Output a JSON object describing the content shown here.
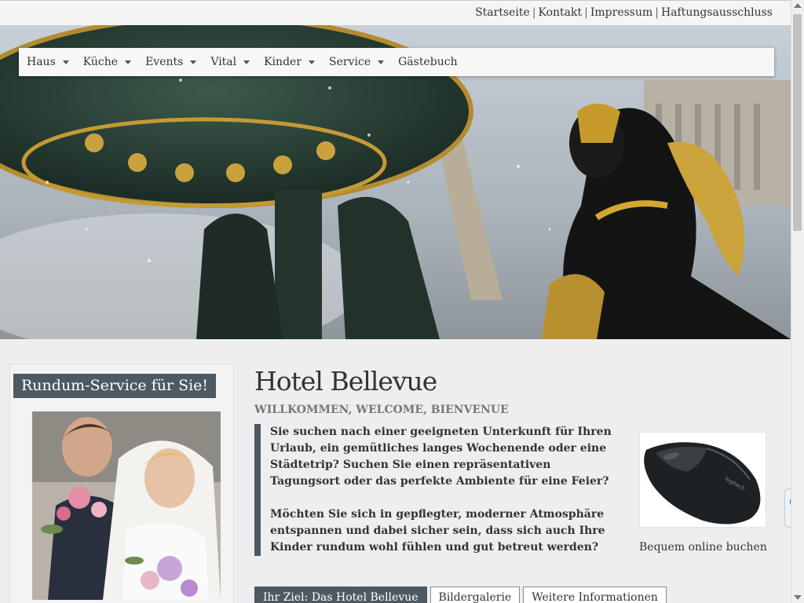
{
  "top_links": [
    {
      "label": "Startseite"
    },
    {
      "label": "Kontakt"
    },
    {
      "label": "Impressum"
    },
    {
      "label": "Haftungsausschluss"
    }
  ],
  "top_links_separator": "|",
  "nav": [
    {
      "label": "Haus",
      "has_dropdown": true
    },
    {
      "label": "Küche",
      "has_dropdown": true
    },
    {
      "label": "Events",
      "has_dropdown": true
    },
    {
      "label": "Vital",
      "has_dropdown": true
    },
    {
      "label": "Kinder",
      "has_dropdown": true
    },
    {
      "label": "Service",
      "has_dropdown": true
    },
    {
      "label": "Gästebuch",
      "has_dropdown": false
    }
  ],
  "sidebar": {
    "title": "Rundum-Service für Sie!"
  },
  "main": {
    "title": "Hotel Bellevue",
    "subtitle": "WILLKOMMEN, WELCOME, BIENVENUE",
    "intro_paragraphs": [
      "Sie suchen nach einer geeigneten Unterkunft für Ihren Urlaub, ein gemütliches langes Wochenende oder eine Städtetrip? Suchen Sie einen repräsentativen Tagungsort oder das perfekte Ambiente für eine Feier?",
      "Möchten Sie sich in gepflegter, moderner Atmosphäre entspannen und dabei sicher sein, dass sich auch Ihre Kinder rundum wohl fühlen und gut betreut werden?"
    ],
    "booking_caption": "Bequem online buchen",
    "tabs": [
      {
        "label": "Ihr Ziel: Das Hotel Bellevue",
        "active": true
      },
      {
        "label": "Bildergalerie",
        "active": false
      },
      {
        "label": "Weitere Informationen",
        "active": false
      }
    ]
  },
  "colors": {
    "accent": "#4e5962",
    "nav_bg": "#f7f7f7",
    "page_bg": "#eeeeee"
  },
  "icons": {
    "dropdown": "caret-down-icon",
    "remote_support": "teamviewer-icon"
  }
}
